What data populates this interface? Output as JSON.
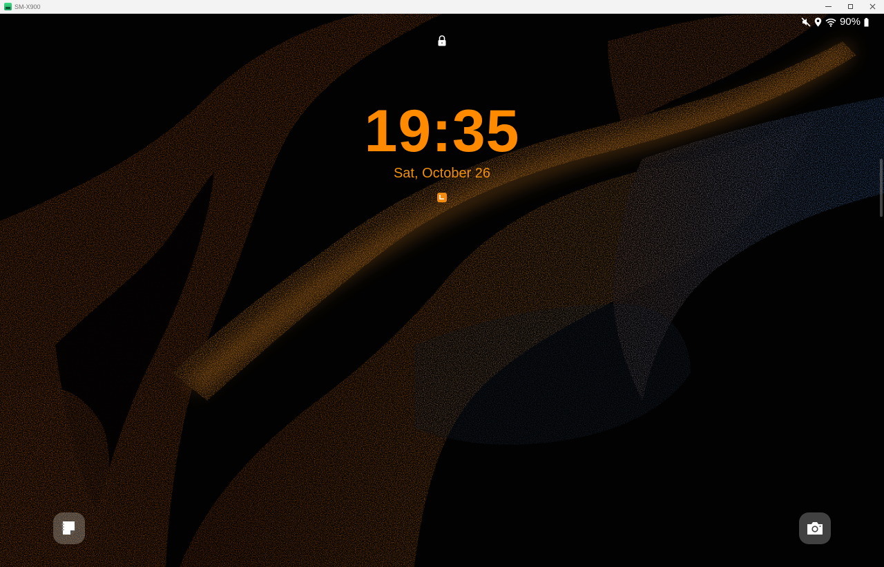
{
  "window": {
    "title": "SM-X900",
    "app_icon": "android-app-icon",
    "controls": [
      "minimize-icon",
      "maximize-icon",
      "close-icon"
    ]
  },
  "status_bar": {
    "icons": [
      "mute-icon",
      "location-icon",
      "wifi-icon",
      "battery-icon"
    ],
    "battery_percent": "90%"
  },
  "lock_screen": {
    "lock_icon": "lock-icon",
    "time": "19:35",
    "date": "Sat, October 26",
    "notification_icon": "notes-notification-icon",
    "accent_color": "#ff8a00"
  },
  "shortcuts": {
    "left": {
      "icon": "samsung-notes-icon"
    },
    "right": {
      "icon": "camera-icon"
    }
  }
}
